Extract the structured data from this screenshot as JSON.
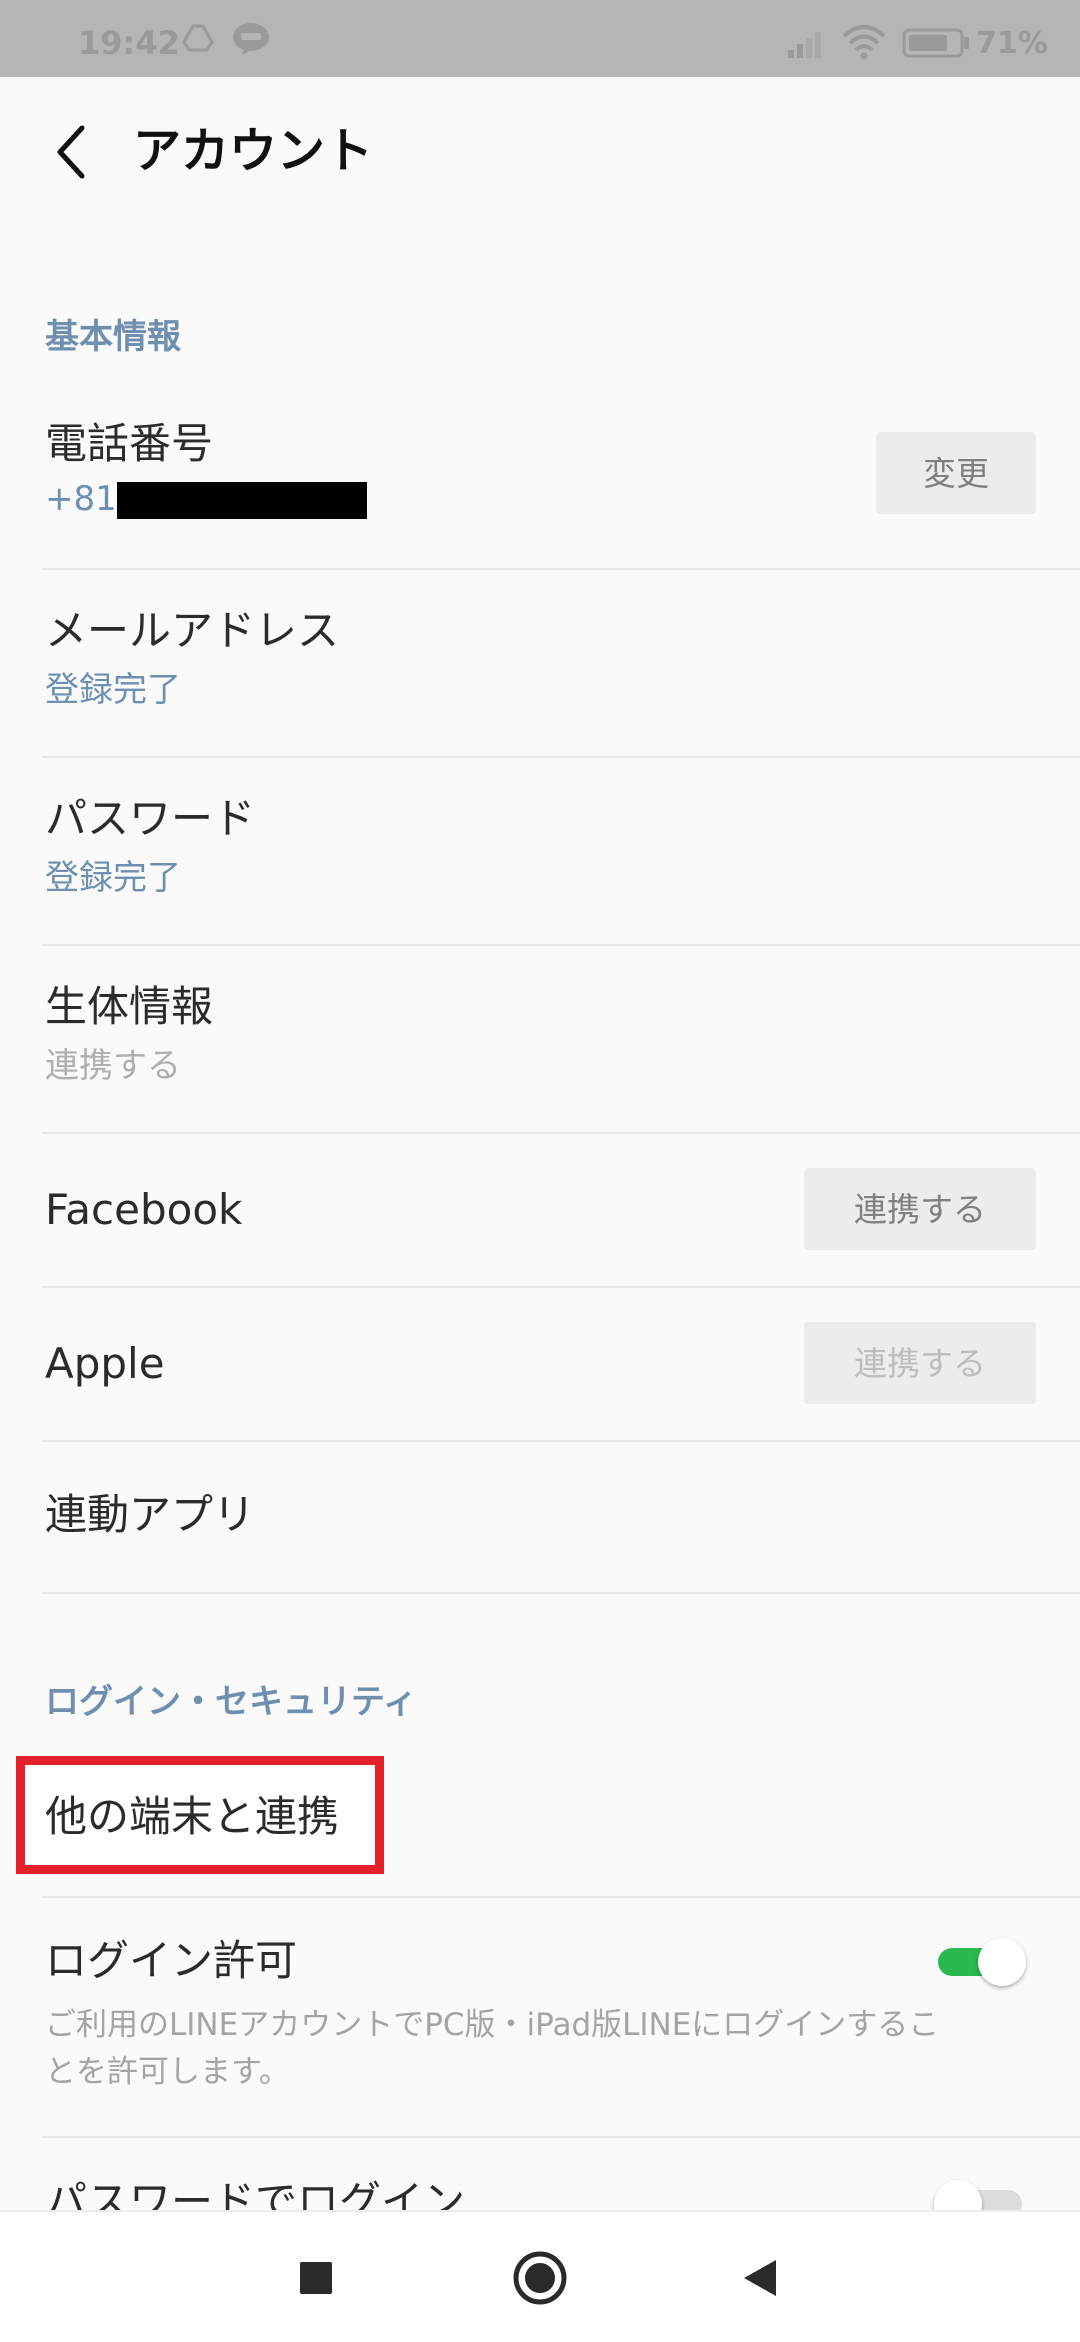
{
  "status_bar": {
    "time": "19:42",
    "battery_percent": "71%",
    "icons": [
      "drive-icon",
      "line-icon",
      "signal-icon",
      "wifi-icon",
      "battery-icon"
    ]
  },
  "header": {
    "title": "アカウント",
    "back_icon": "chevron-left-icon"
  },
  "sections": {
    "basic_info": {
      "header": "基本情報",
      "phone": {
        "label": "電話番号",
        "value": "+81",
        "button": "変更"
      },
      "email": {
        "label": "メールアドレス",
        "value": "登録完了"
      },
      "password": {
        "label": "パスワード",
        "value": "登録完了"
      },
      "biometrics": {
        "label": "生体情報",
        "value": "連携する"
      },
      "facebook": {
        "label": "Facebook",
        "button": "連携する"
      },
      "apple": {
        "label": "Apple",
        "button": "連携する"
      },
      "linked_apps": {
        "label": "連動アプリ"
      }
    },
    "login_security": {
      "header": "ログイン・セキュリティ",
      "other_devices": {
        "label": "他の端末と連携"
      },
      "login_permission": {
        "label": "ログイン許可",
        "description": "ご利用のLINEアカウントでPC版・iPad版LINEにログインすることを許可します。",
        "enabled": true
      },
      "password_login": {
        "label": "パスワードでログイン",
        "enabled": false
      }
    }
  },
  "colors": {
    "accent_blue": "#6f8fb0",
    "toggle_on": "#2bb84f",
    "highlight_red": "#e4212a"
  },
  "nav_bar": {
    "icons": [
      "recents-square-icon",
      "home-circle-icon",
      "back-triangle-icon"
    ]
  }
}
